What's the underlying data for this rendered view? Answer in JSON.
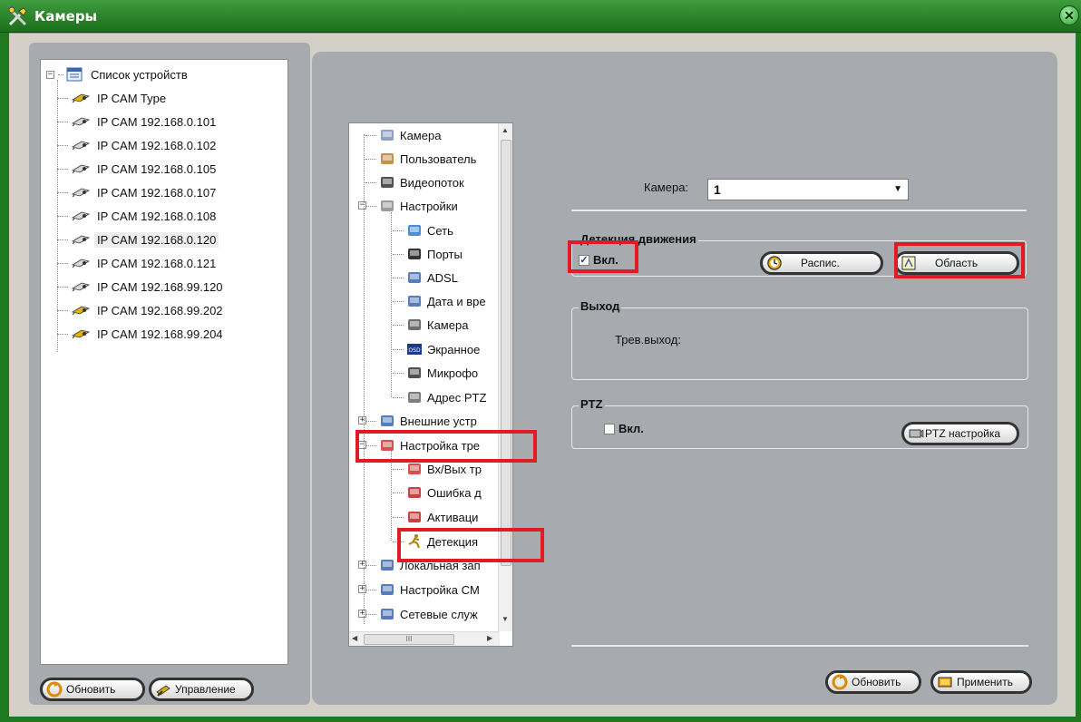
{
  "window": {
    "title": "Камеры",
    "close_symbol": "✕"
  },
  "device_tree": {
    "root_label": "Список устройств",
    "items": [
      "IP CAM Type",
      "IP CAM 192.168.0.101",
      "IP CAM 192.168.0.102",
      "IP CAM 192.168.0.105",
      "IP CAM 192.168.0.107",
      "IP CAM 192.168.0.108",
      "IP CAM 192.168.0.120",
      "IP CAM 192.168.0.121",
      "IP CAM 192.168.99.120",
      "IP CAM 192.168.99.202",
      "IP CAM 192.168.99.204"
    ],
    "selected_item": "IP CAM 192.168.0.120"
  },
  "left_buttons": {
    "refresh": "Обновить",
    "manage": "Управление"
  },
  "settings_tree": {
    "items": [
      {
        "label": "Камера",
        "icon": "document-icon"
      },
      {
        "label": "Пользователь",
        "icon": "users-icon"
      },
      {
        "label": "Видеопоток",
        "icon": "video-icon"
      },
      {
        "label": "Настройки",
        "icon": "tools-icon"
      },
      {
        "label": "Сеть",
        "icon": "network-icon"
      },
      {
        "label": "Порты",
        "icon": "port-icon"
      },
      {
        "label": "ADSL",
        "icon": "adsl-icon"
      },
      {
        "label": "Дата и вре",
        "icon": "calendar-icon"
      },
      {
        "label": "Камера",
        "icon": "camera-icon"
      },
      {
        "label": "Экранное",
        "icon": "osd-icon"
      },
      {
        "label": "Микрофо",
        "icon": "microphone-icon"
      },
      {
        "label": "Адрес PTZ",
        "icon": "ptz-icon"
      },
      {
        "label": "Внешние устр",
        "icon": "external-device-icon"
      },
      {
        "label": "Настройка тре",
        "icon": "alarm-settings-icon"
      },
      {
        "label": "Вх/Вых тр",
        "icon": "io-alarm-icon"
      },
      {
        "label": "Ошибка д",
        "icon": "disk-error-icon"
      },
      {
        "label": "Активаци",
        "icon": "activation-icon"
      },
      {
        "label": "Детекция",
        "icon": "motion-detection-icon"
      },
      {
        "label": "Локальная зап",
        "icon": "local-record-icon"
      },
      {
        "label": "Настройка CM",
        "icon": "cms-settings-icon"
      },
      {
        "label": "Сетевые служ",
        "icon": "network-services-icon"
      }
    ],
    "osd_text": "OSD",
    "hscroll_thumb": "III"
  },
  "camera": {
    "label": "Камера:",
    "value": "1"
  },
  "motion_detection": {
    "title": "Детекция движения",
    "enabled_label": "Вкл.",
    "enabled": true,
    "schedule_button": "Распис.",
    "area_button": "Область"
  },
  "output": {
    "title": "Выход",
    "alarm_output_label": "Трев.выход:"
  },
  "ptz": {
    "title": "PTZ",
    "enabled_label": "Вкл.",
    "enabled": false,
    "settings_button": "PTZ настройка"
  },
  "bottom_buttons": {
    "refresh": "Обновить",
    "apply": "Применить"
  },
  "colors": {
    "highlight": "#e01b24",
    "title_bar": "#2e8b2e",
    "panel": "#a7aaaf"
  }
}
